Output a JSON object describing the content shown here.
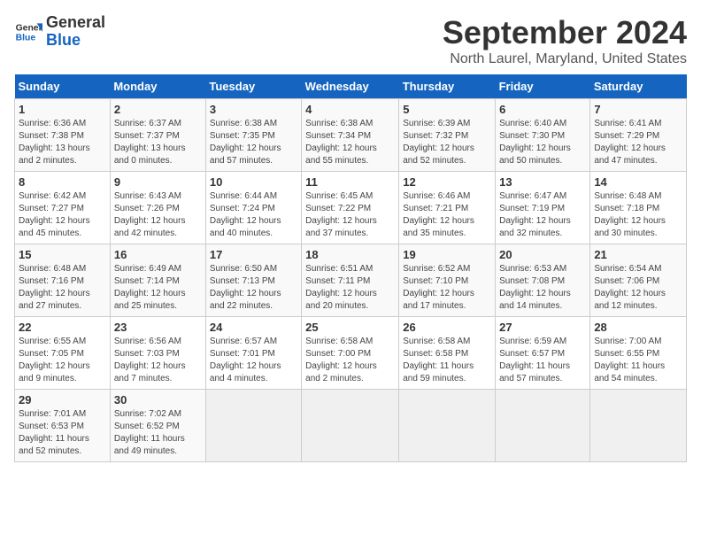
{
  "header": {
    "logo_line1": "General",
    "logo_line2": "Blue",
    "month": "September 2024",
    "location": "North Laurel, Maryland, United States"
  },
  "weekdays": [
    "Sunday",
    "Monday",
    "Tuesday",
    "Wednesday",
    "Thursday",
    "Friday",
    "Saturday"
  ],
  "weeks": [
    [
      {
        "day": "1",
        "info": "Sunrise: 6:36 AM\nSunset: 7:38 PM\nDaylight: 13 hours\nand 2 minutes."
      },
      {
        "day": "2",
        "info": "Sunrise: 6:37 AM\nSunset: 7:37 PM\nDaylight: 13 hours\nand 0 minutes."
      },
      {
        "day": "3",
        "info": "Sunrise: 6:38 AM\nSunset: 7:35 PM\nDaylight: 12 hours\nand 57 minutes."
      },
      {
        "day": "4",
        "info": "Sunrise: 6:38 AM\nSunset: 7:34 PM\nDaylight: 12 hours\nand 55 minutes."
      },
      {
        "day": "5",
        "info": "Sunrise: 6:39 AM\nSunset: 7:32 PM\nDaylight: 12 hours\nand 52 minutes."
      },
      {
        "day": "6",
        "info": "Sunrise: 6:40 AM\nSunset: 7:30 PM\nDaylight: 12 hours\nand 50 minutes."
      },
      {
        "day": "7",
        "info": "Sunrise: 6:41 AM\nSunset: 7:29 PM\nDaylight: 12 hours\nand 47 minutes."
      }
    ],
    [
      {
        "day": "8",
        "info": "Sunrise: 6:42 AM\nSunset: 7:27 PM\nDaylight: 12 hours\nand 45 minutes."
      },
      {
        "day": "9",
        "info": "Sunrise: 6:43 AM\nSunset: 7:26 PM\nDaylight: 12 hours\nand 42 minutes."
      },
      {
        "day": "10",
        "info": "Sunrise: 6:44 AM\nSunset: 7:24 PM\nDaylight: 12 hours\nand 40 minutes."
      },
      {
        "day": "11",
        "info": "Sunrise: 6:45 AM\nSunset: 7:22 PM\nDaylight: 12 hours\nand 37 minutes."
      },
      {
        "day": "12",
        "info": "Sunrise: 6:46 AM\nSunset: 7:21 PM\nDaylight: 12 hours\nand 35 minutes."
      },
      {
        "day": "13",
        "info": "Sunrise: 6:47 AM\nSunset: 7:19 PM\nDaylight: 12 hours\nand 32 minutes."
      },
      {
        "day": "14",
        "info": "Sunrise: 6:48 AM\nSunset: 7:18 PM\nDaylight: 12 hours\nand 30 minutes."
      }
    ],
    [
      {
        "day": "15",
        "info": "Sunrise: 6:48 AM\nSunset: 7:16 PM\nDaylight: 12 hours\nand 27 minutes."
      },
      {
        "day": "16",
        "info": "Sunrise: 6:49 AM\nSunset: 7:14 PM\nDaylight: 12 hours\nand 25 minutes."
      },
      {
        "day": "17",
        "info": "Sunrise: 6:50 AM\nSunset: 7:13 PM\nDaylight: 12 hours\nand 22 minutes."
      },
      {
        "day": "18",
        "info": "Sunrise: 6:51 AM\nSunset: 7:11 PM\nDaylight: 12 hours\nand 20 minutes."
      },
      {
        "day": "19",
        "info": "Sunrise: 6:52 AM\nSunset: 7:10 PM\nDaylight: 12 hours\nand 17 minutes."
      },
      {
        "day": "20",
        "info": "Sunrise: 6:53 AM\nSunset: 7:08 PM\nDaylight: 12 hours\nand 14 minutes."
      },
      {
        "day": "21",
        "info": "Sunrise: 6:54 AM\nSunset: 7:06 PM\nDaylight: 12 hours\nand 12 minutes."
      }
    ],
    [
      {
        "day": "22",
        "info": "Sunrise: 6:55 AM\nSunset: 7:05 PM\nDaylight: 12 hours\nand 9 minutes."
      },
      {
        "day": "23",
        "info": "Sunrise: 6:56 AM\nSunset: 7:03 PM\nDaylight: 12 hours\nand 7 minutes."
      },
      {
        "day": "24",
        "info": "Sunrise: 6:57 AM\nSunset: 7:01 PM\nDaylight: 12 hours\nand 4 minutes."
      },
      {
        "day": "25",
        "info": "Sunrise: 6:58 AM\nSunset: 7:00 PM\nDaylight: 12 hours\nand 2 minutes."
      },
      {
        "day": "26",
        "info": "Sunrise: 6:58 AM\nSunset: 6:58 PM\nDaylight: 11 hours\nand 59 minutes."
      },
      {
        "day": "27",
        "info": "Sunrise: 6:59 AM\nSunset: 6:57 PM\nDaylight: 11 hours\nand 57 minutes."
      },
      {
        "day": "28",
        "info": "Sunrise: 7:00 AM\nSunset: 6:55 PM\nDaylight: 11 hours\nand 54 minutes."
      }
    ],
    [
      {
        "day": "29",
        "info": "Sunrise: 7:01 AM\nSunset: 6:53 PM\nDaylight: 11 hours\nand 52 minutes."
      },
      {
        "day": "30",
        "info": "Sunrise: 7:02 AM\nSunset: 6:52 PM\nDaylight: 11 hours\nand 49 minutes."
      },
      {
        "day": "",
        "info": ""
      },
      {
        "day": "",
        "info": ""
      },
      {
        "day": "",
        "info": ""
      },
      {
        "day": "",
        "info": ""
      },
      {
        "day": "",
        "info": ""
      }
    ]
  ]
}
